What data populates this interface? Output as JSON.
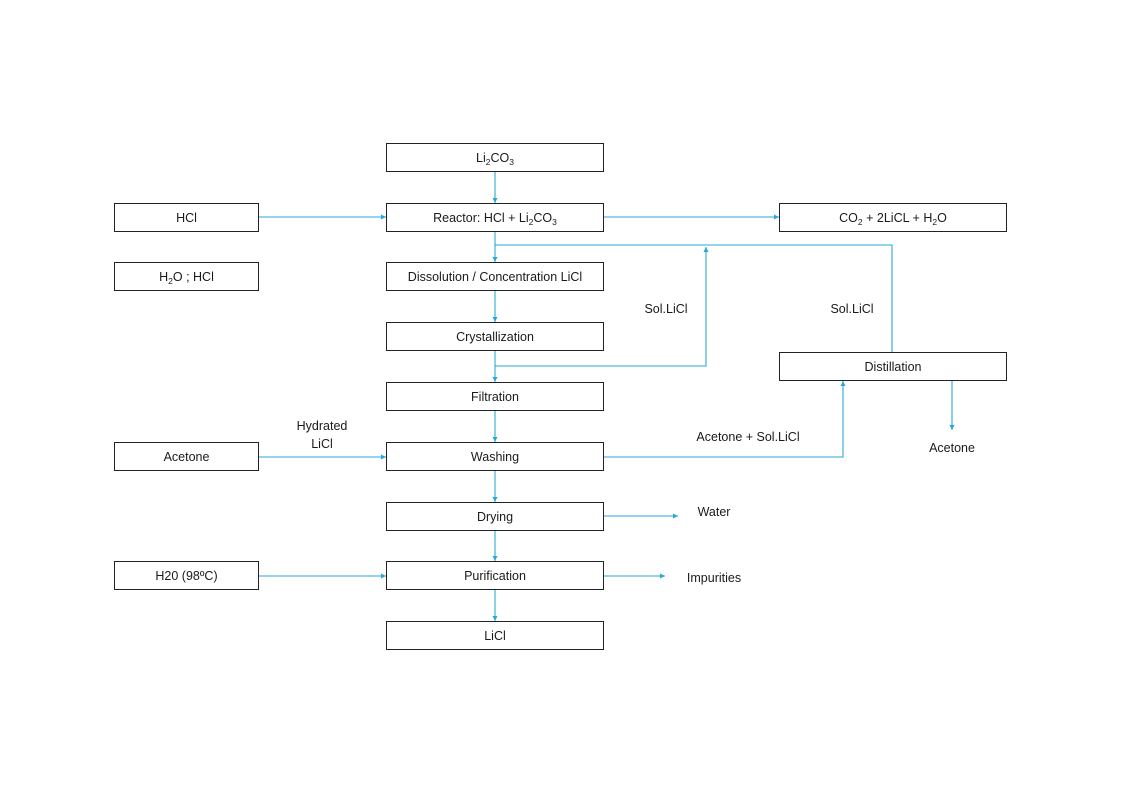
{
  "diagram": {
    "colors": {
      "connector": "#29a8d4",
      "box_border": "#222222"
    },
    "boxes": {
      "li2co3": {
        "parts": [
          [
            "Li",
            ""
          ],
          [
            "2",
            "sub"
          ],
          [
            "CO",
            ""
          ],
          [
            "3",
            "sub"
          ]
        ]
      },
      "reactor": {
        "parts": [
          [
            "Reactor: HCl + Li",
            ""
          ],
          [
            "2",
            "sub"
          ],
          [
            "CO",
            ""
          ],
          [
            "3",
            "sub"
          ]
        ]
      },
      "products": {
        "parts": [
          [
            "CO",
            ""
          ],
          [
            "2",
            "sub"
          ],
          [
            " + 2LiCL + H",
            ""
          ],
          [
            "2",
            "sub"
          ],
          [
            "O",
            ""
          ]
        ]
      },
      "hcl": {
        "parts": [
          [
            "HCl",
            ""
          ]
        ]
      },
      "h2o_hcl": {
        "parts": [
          [
            "H",
            ""
          ],
          [
            "2",
            "sub"
          ],
          [
            "O ; HCl",
            ""
          ]
        ]
      },
      "dissolution": {
        "parts": [
          [
            "Dissolution / Concentration LiCl",
            ""
          ]
        ]
      },
      "crystallization": {
        "parts": [
          [
            "Crystallization",
            ""
          ]
        ]
      },
      "filtration": {
        "parts": [
          [
            "Filtration",
            ""
          ]
        ]
      },
      "distillation": {
        "parts": [
          [
            "Distillation",
            ""
          ]
        ]
      },
      "acetone_in": {
        "parts": [
          [
            "Acetone",
            ""
          ]
        ]
      },
      "washing": {
        "parts": [
          [
            "Washing",
            ""
          ]
        ]
      },
      "drying": {
        "parts": [
          [
            "Drying",
            ""
          ]
        ]
      },
      "h2o_98": {
        "parts": [
          [
            "H20 (98ºC)",
            ""
          ]
        ]
      },
      "purification": {
        "parts": [
          [
            "Purification",
            ""
          ]
        ]
      },
      "licl": {
        "parts": [
          [
            "LiCl",
            ""
          ]
        ]
      }
    },
    "labels": {
      "sol_licl_1": "Sol.LiCl",
      "sol_licl_2": "Sol.LiCl",
      "hydrated_1": "Hydrated",
      "hydrated_2": "LiCl",
      "acetone_sol": "Acetone + Sol.LiCl",
      "acetone_out": "Acetone",
      "water": "Water",
      "impurities": "Impurities"
    }
  }
}
